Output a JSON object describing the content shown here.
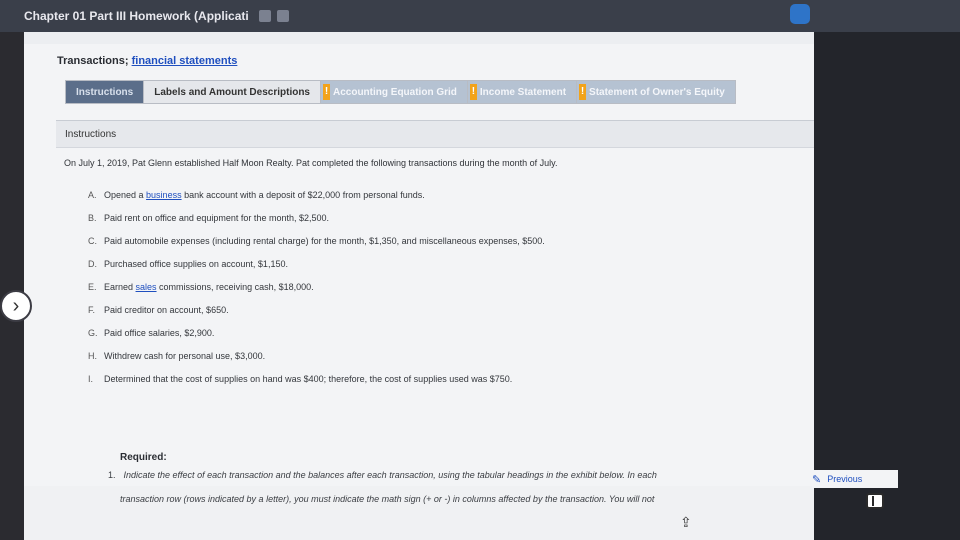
{
  "app": {
    "window_title": "Chapter 01 Part III Homework (Applicati"
  },
  "section": {
    "title_prefix": "Transactions;",
    "title_link": "financial statements"
  },
  "tabs": [
    {
      "label": "Instructions",
      "state": "active"
    },
    {
      "label": "Labels and Amount Descriptions",
      "state": "normal"
    },
    {
      "label": "Accounting Equation Grid",
      "state": "warn"
    },
    {
      "label": "Income Statement",
      "state": "warn"
    },
    {
      "label": "Statement of Owner's Equity",
      "state": "warn"
    }
  ],
  "warn_mark": "!",
  "panel": {
    "header": "Instructions",
    "intro": "On July 1, 2019, Pat Glenn established Half Moon Realty. Pat completed the following transactions during the month of July."
  },
  "transactions": [
    {
      "letter": "A.",
      "pre": "Opened a ",
      "link": "business",
      "post": " bank account with a deposit of $22,000 from personal funds."
    },
    {
      "letter": "B.",
      "pre": "Paid rent on office and equipment for the month, $2,500.",
      "link": "",
      "post": ""
    },
    {
      "letter": "C.",
      "pre": "Paid automobile expenses (including rental charge) for the month, $1,350, and miscellaneous expenses, $500.",
      "link": "",
      "post": ""
    },
    {
      "letter": "D.",
      "pre": "Purchased office supplies on account, $1,150.",
      "link": "",
      "post": ""
    },
    {
      "letter": "E.",
      "pre": "Earned ",
      "link": "sales",
      "post": " commissions, receiving cash, $18,000."
    },
    {
      "letter": "F.",
      "pre": "Paid creditor on account, $650.",
      "link": "",
      "post": ""
    },
    {
      "letter": "G.",
      "pre": "Paid office salaries, $2,900.",
      "link": "",
      "post": ""
    },
    {
      "letter": "H.",
      "pre": "Withdrew cash for personal use, $3,000.",
      "link": "",
      "post": ""
    },
    {
      "letter": "I.",
      "pre": "Determined that the cost of supplies on hand was $400; therefore, the cost of supplies used was $750.",
      "link": "",
      "post": ""
    }
  ],
  "required": {
    "label": "Required:",
    "number": "1.",
    "line1": "Indicate the effect of each transaction and the balances after each transaction, using the tabular headings in the exhibit below. In each",
    "line2": "transaction row (rows indicated by a letter), you must indicate the math sign (+ or -) in columns affected by the transaction. You will not"
  },
  "nav": {
    "previous_label": "Previous"
  },
  "icons": {
    "chevron": "chevron-right-icon",
    "share": "share-icon",
    "pencil": "pencil-icon",
    "sidebar": "sidebar-toggle-icon"
  },
  "colors": {
    "link": "#1f4fbf",
    "active_tab": "#5b6e8a",
    "warn": "#f2a31a"
  }
}
